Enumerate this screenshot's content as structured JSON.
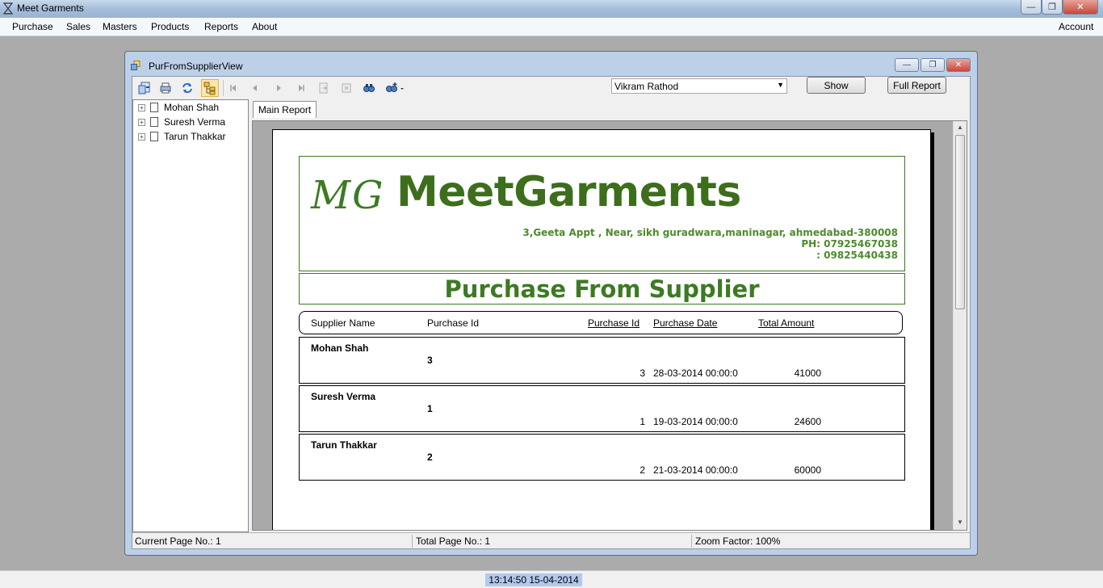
{
  "app": {
    "title": "Meet Garments"
  },
  "menu": {
    "items": [
      "Purchase",
      "Sales",
      "Masters",
      "Products",
      "Reports",
      "About"
    ],
    "account": "Account"
  },
  "child": {
    "title": "PurFromSupplierView"
  },
  "toolbar": {
    "icons": [
      "export-icon",
      "print-icon",
      "refresh-icon",
      "toggle-tree-icon",
      "first-page-icon",
      "previous-page-icon",
      "next-page-icon",
      "last-page-icon",
      "goto-page-icon",
      "stop-icon",
      "search-icon",
      "zoom-icon"
    ],
    "supplier_select": "Vikram Rathod",
    "show_label": "Show",
    "full_report_label": "Full Report"
  },
  "tree": {
    "items": [
      "Mohan Shah",
      "Suresh Verma",
      "Tarun Thakkar"
    ]
  },
  "tab": {
    "label": "Main Report"
  },
  "report": {
    "logo": "MG",
    "company": "MeetGarments",
    "address": "3,Geeta Appt , Near, sikh guradwara,maninagar, ahmedabad-380008",
    "phone": "PH: 07925467038",
    "phone2": ": 09825440438",
    "title": "Purchase From Supplier",
    "columns": {
      "supplier_name": "Supplier Name",
      "purchase_id_group": "Purchase Id",
      "purchase_id": "Purchase Id",
      "purchase_date": "Purchase Date",
      "total_amount": "Total Amount"
    },
    "groups": [
      {
        "name": "Mohan Shah",
        "group_id": "3",
        "purchase_id": "3",
        "date": "28-03-2014  00:00:0",
        "amount": "41000"
      },
      {
        "name": "Suresh Verma",
        "group_id": "1",
        "purchase_id": "1",
        "date": "19-03-2014  00:00:0",
        "amount": "24600"
      },
      {
        "name": "Tarun Thakkar",
        "group_id": "2",
        "purchase_id": "2",
        "date": "21-03-2014  00:00:0",
        "amount": "60000"
      }
    ]
  },
  "status": {
    "current_page": "Current Page No.: 1",
    "total_page": "Total Page No.: 1",
    "zoom": "Zoom Factor: 100%"
  },
  "clock": "13:14:50 15-04-2014"
}
